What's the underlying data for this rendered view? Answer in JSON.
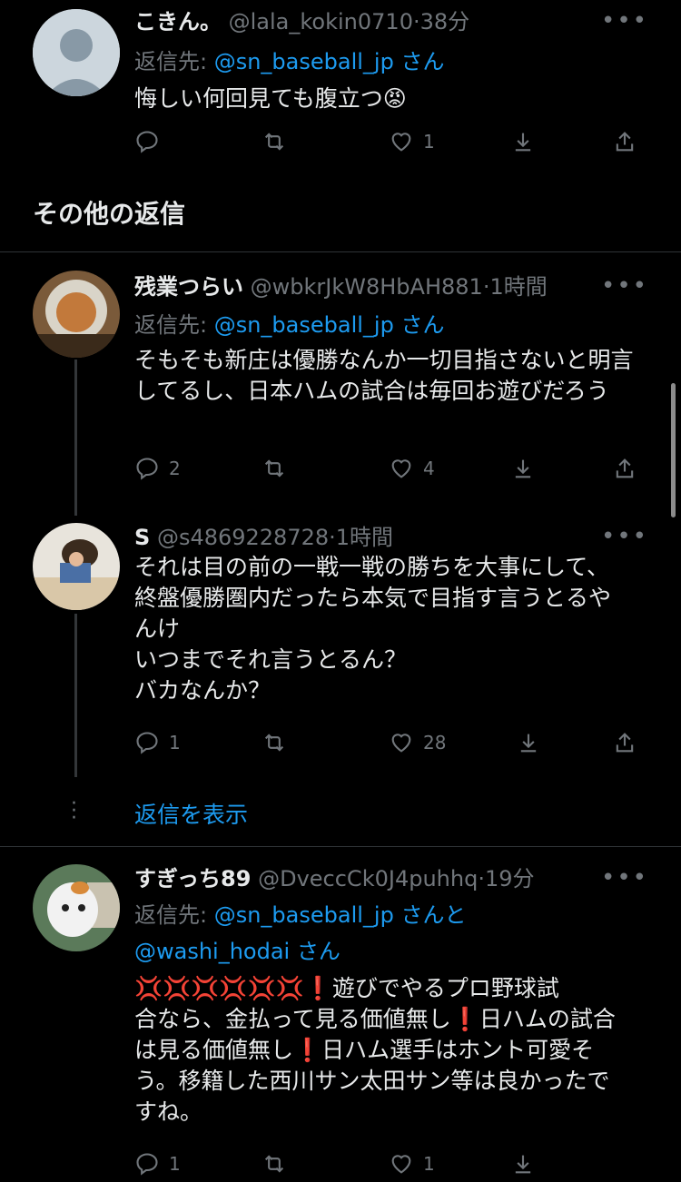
{
  "tweets": [
    {
      "name": "こきん。",
      "handle": "@lala_kokin0710",
      "time": "38分",
      "reply_prefix": "返信先: ",
      "reply_to": "@sn_baseball_jp",
      "reply_suffix": " さん",
      "text": "悔しい何回見ても腹立つ😡",
      "reply_count": "",
      "retweet_count": "",
      "like_count": "1"
    },
    {
      "name": "残業つらい",
      "handle": "@wbkrJkW8HbAH881",
      "time": "1時間",
      "reply_prefix": "返信先: ",
      "reply_to": "@sn_baseball_jp",
      "reply_suffix": " さん",
      "text": "そもそも新庄は優勝なんか一切目指さないと明言してるし、日本ハムの試合は毎回お遊びだろう",
      "reply_count": "2",
      "retweet_count": "",
      "like_count": "4"
    },
    {
      "name": "S",
      "handle": "@s4869228728",
      "time": "1時間",
      "text_lines": [
        "それは目の前の一戦一戦の勝ちを大事にして、",
        "終盤優勝圏内だったら本気で目指す言うとるや",
        "んけ",
        "いつまでそれ言うとるん？",
        "バカなんか？"
      ],
      "reply_count": "1",
      "retweet_count": "",
      "like_count": "28"
    },
    {
      "name": "すぎっち89",
      "handle": "@DveccCk0J4puhhq",
      "time": "19分",
      "reply_prefix": "返信先: ",
      "reply_to": "@sn_baseball_jp",
      "reply_middle": " さんと",
      "reply_to2": "@washi_hodai",
      "reply_suffix": " さん",
      "text_lines": [
        "💢💢💢💢💢💢❗️遊びでやるプロ野球試",
        "合なら、金払って見る価値無し❗️日ハムの試合",
        "は見る価値無し❗️日ハム選手はホント可愛そ",
        "う。移籍した西川サン太田サン等は良かったで",
        "すね。"
      ],
      "reply_count": "1",
      "like_count": "1"
    }
  ],
  "section_title": "その他の返信",
  "show_replies": "返信を表示",
  "dot": "·",
  "more": "•••",
  "colors": {
    "link": "#1d9bf0",
    "muted": "#71767b",
    "background": "#000000"
  }
}
